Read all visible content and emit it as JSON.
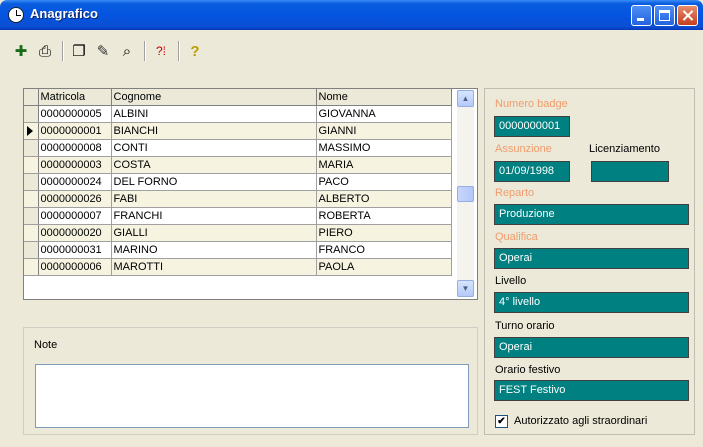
{
  "window": {
    "title": "Anagrafico"
  },
  "toolbar": {
    "icons": [
      "new-record-icon",
      "print-icon",
      "copy-icon",
      "edit-icon",
      "search-icon",
      "help-context-icon",
      "help-icon"
    ]
  },
  "grid": {
    "columns": [
      "Matricola",
      "Cognome",
      "Nome"
    ],
    "current_row": 1,
    "rows": [
      [
        "0000000005",
        "ALBINI",
        "GIOVANNA"
      ],
      [
        "0000000001",
        "BIANCHI",
        "GIANNI"
      ],
      [
        "0000000008",
        "CONTI",
        "MASSIMO"
      ],
      [
        "0000000003",
        "COSTA",
        "MARIA"
      ],
      [
        "0000000024",
        "DEL FORNO",
        "PACO"
      ],
      [
        "0000000026",
        "FABI",
        "ALBERTO"
      ],
      [
        "0000000007",
        "FRANCHI",
        "ROBERTA"
      ],
      [
        "0000000020",
        "GIALLI",
        "PIERO"
      ],
      [
        "0000000031",
        "MARINO",
        "FRANCO"
      ],
      [
        "0000000006",
        "MAROTTI",
        "PAOLA"
      ]
    ]
  },
  "note": {
    "label": "Note",
    "value": ""
  },
  "details": {
    "numero_badge_label": "Numero badge",
    "numero_badge": "0000000001",
    "assunzione_label": "Assunzione",
    "assunzione": "01/09/1998",
    "licenziamento_label": "Licenziamento",
    "licenziamento": "",
    "reparto_label": "Reparto",
    "reparto": "Produzione",
    "qualifica_label": "Qualifica",
    "qualifica": "Operai",
    "livello_label": "Livello",
    "livello": "4° livello",
    "turno_label": "Turno orario",
    "turno": "Operai",
    "festivo_label": "Orario festivo",
    "festivo": "FEST  Festivo",
    "straordinari_label": "Autorizzato agli straordinari",
    "straordinari_checked": true
  },
  "colors": {
    "field_bg": "#008080",
    "muted_label": "#f09c6c",
    "title_bar": "#0454e0",
    "alt_row": "#f6f4e1"
  }
}
